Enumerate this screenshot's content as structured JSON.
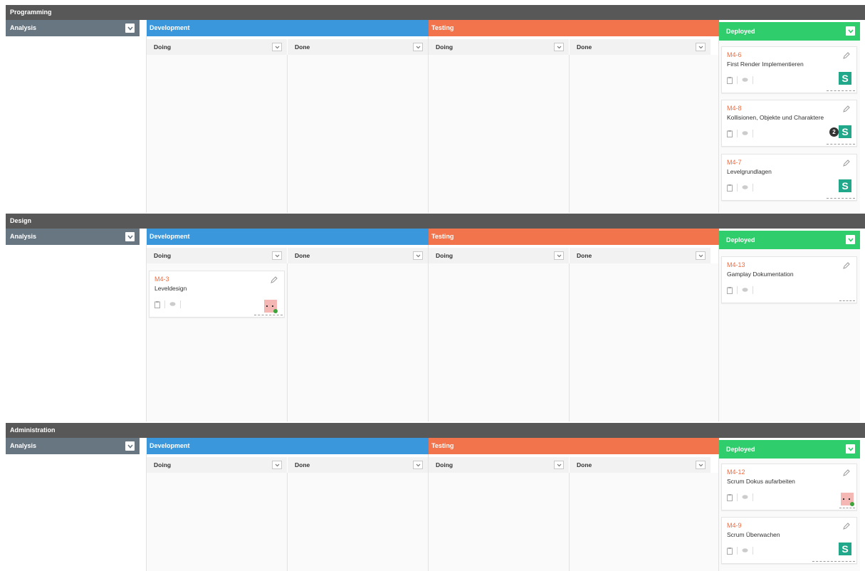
{
  "swimlanes": [
    {
      "title": "Programming",
      "columns": {
        "analysis": "Analysis",
        "development": "Development",
        "testing": "Testing",
        "deployed": "Deployed"
      },
      "subcolumns": [
        "Doing",
        "Done",
        "Doing",
        "Done"
      ],
      "cards": [
        {
          "id": "M4-6",
          "title": "First Render Implementieren",
          "avatar": "S"
        },
        {
          "id": "M4-8",
          "title": "Kollisionen, Objekte und Charaktere",
          "avatar": "S",
          "badge": "2"
        },
        {
          "id": "M4-7",
          "title": "Levelgrundlagen",
          "avatar": "S"
        }
      ]
    },
    {
      "title": "Design",
      "columns": {
        "analysis": "Analysis",
        "development": "Development",
        "testing": "Testing",
        "deployed": "Deployed"
      },
      "subcolumns": [
        "Doing",
        "Done",
        "Doing",
        "Done"
      ],
      "cards": [
        {
          "id": "M4-3",
          "title": "Leveldesign",
          "avatar": "pig"
        },
        {
          "id": "M4-13",
          "title": "Gamplay Dokumentation",
          "avatar": ""
        }
      ]
    },
    {
      "title": "Administration",
      "columns": {
        "analysis": "Analysis",
        "development": "Development",
        "testing": "Testing",
        "deployed": "Deployed"
      },
      "subcolumns": [
        "Doing",
        "Done",
        "Doing",
        "Done"
      ],
      "cards": [
        {
          "id": "M4-12",
          "title": "Scrum Dokus aufarbeiten",
          "avatar": "pig"
        },
        {
          "id": "M4-9",
          "title": "Scrum Überwachen",
          "avatar": "S"
        }
      ]
    }
  ],
  "colors": {
    "swimlane_header": "#585858",
    "analysis": "#687682",
    "development": "#3a97dc",
    "testing": "#f2744d",
    "deployed": "#2fcd6b",
    "card_id": "#ef6a3e",
    "avatar_s": "#21a78a"
  }
}
